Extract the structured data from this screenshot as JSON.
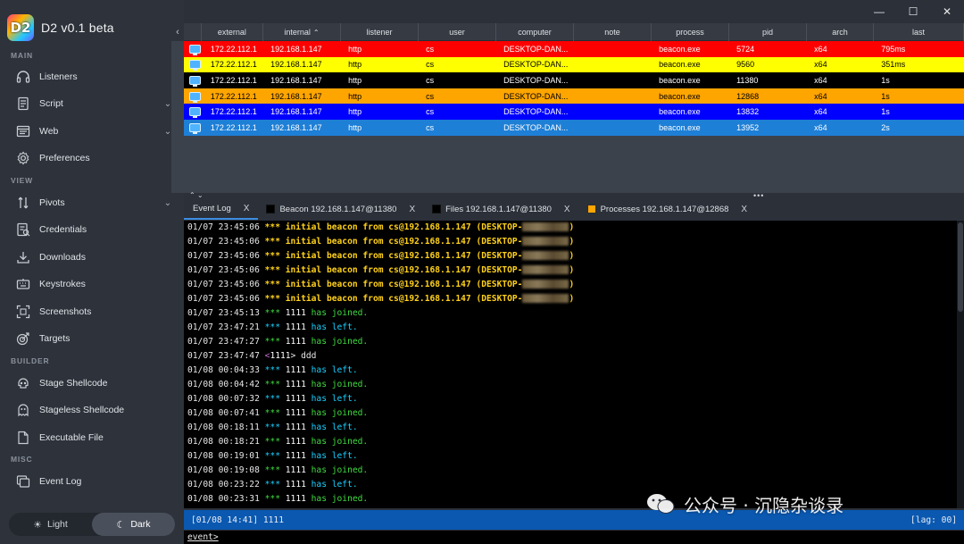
{
  "app": {
    "title": "D2 v0.1 beta",
    "logo_text": "D2"
  },
  "colors": {
    "red": "#ff0000",
    "yellow": "#ffff00",
    "black": "#000000",
    "orange": "#ffa500",
    "blue": "#0000ff",
    "lightblue": "#1e7fd6"
  },
  "sidebar": {
    "sections": {
      "main": "MAIN",
      "view": "VIEW",
      "builder": "BUILDER",
      "misc": "MISC"
    },
    "items": {
      "listeners": {
        "label": "Listeners",
        "icon": "headphones-icon"
      },
      "script": {
        "label": "Script",
        "icon": "script-icon"
      },
      "web": {
        "label": "Web",
        "icon": "web-icon"
      },
      "preferences": {
        "label": "Preferences",
        "icon": "gear-icon"
      },
      "pivots": {
        "label": "Pivots",
        "icon": "pivots-icon"
      },
      "credentials": {
        "label": "Credentials",
        "icon": "credentials-icon"
      },
      "downloads": {
        "label": "Downloads",
        "icon": "download-icon"
      },
      "keystrokes": {
        "label": "Keystrokes",
        "icon": "keyboard-icon"
      },
      "screenshots": {
        "label": "Screenshots",
        "icon": "screenshot-icon"
      },
      "targets": {
        "label": "Targets",
        "icon": "target-icon"
      },
      "stage_shellcode": {
        "label": "Stage Shellcode",
        "icon": "skull-icon"
      },
      "stageless_shellcode": {
        "label": "Stageless Shellcode",
        "icon": "ghost-icon"
      },
      "executable_file": {
        "label": "Executable File",
        "icon": "file-icon"
      },
      "event_log": {
        "label": "Event Log",
        "icon": "event-log-icon"
      }
    },
    "theme": {
      "light": "Light",
      "dark": "Dark"
    }
  },
  "table": {
    "columns": [
      "external",
      "internal",
      "listener",
      "user",
      "computer",
      "note",
      "process",
      "pid",
      "arch",
      "last"
    ],
    "sorted_column": "internal",
    "rows": [
      {
        "color": "red",
        "text": "#ffffff",
        "external": "172.22.112.1",
        "internal": "192.168.1.147",
        "listener": "http",
        "user": "cs",
        "computer": "DESKTOP-DAN...",
        "note": "",
        "process": "beacon.exe",
        "pid": "5724",
        "arch": "x64",
        "last": "795ms"
      },
      {
        "color": "yellow",
        "text": "#000000",
        "external": "172.22.112.1",
        "internal": "192.168.1.147",
        "listener": "http",
        "user": "cs",
        "computer": "DESKTOP-DAN...",
        "note": "",
        "process": "beacon.exe",
        "pid": "9560",
        "arch": "x64",
        "last": "351ms"
      },
      {
        "color": "black",
        "text": "#ffffff",
        "external": "172.22.112.1",
        "internal": "192.168.1.147",
        "listener": "http",
        "user": "cs",
        "computer": "DESKTOP-DAN...",
        "note": "",
        "process": "beacon.exe",
        "pid": "11380",
        "arch": "x64",
        "last": "1s"
      },
      {
        "color": "orange",
        "text": "#000000",
        "external": "172.22.112.1",
        "internal": "192.168.1.147",
        "listener": "http",
        "user": "cs",
        "computer": "DESKTOP-DAN...",
        "note": "",
        "process": "beacon.exe",
        "pid": "12868",
        "arch": "x64",
        "last": "1s"
      },
      {
        "color": "blue",
        "text": "#ffffff",
        "external": "172.22.112.1",
        "internal": "192.168.1.147",
        "listener": "http",
        "user": "cs",
        "computer": "DESKTOP-DAN...",
        "note": "",
        "process": "beacon.exe",
        "pid": "13832",
        "arch": "x64",
        "last": "1s"
      },
      {
        "color": "lightblue",
        "text": "#ffffff",
        "external": "172.22.112.1",
        "internal": "192.168.1.147",
        "listener": "http",
        "user": "cs",
        "computer": "DESKTOP-DAN...",
        "note": "",
        "process": "beacon.exe",
        "pid": "13952",
        "arch": "x64",
        "last": "2s"
      }
    ]
  },
  "tabs": [
    {
      "label": "Event Log",
      "close": "X",
      "active": true,
      "swatch": ""
    },
    {
      "label": "Beacon 192.168.1.147@11380",
      "close": "X",
      "active": false,
      "swatch": "#000000"
    },
    {
      "label": "Files 192.168.1.147@11380",
      "close": "X",
      "active": false,
      "swatch": "#000000"
    },
    {
      "label": "Processes 192.168.1.147@12868",
      "close": "X",
      "active": false,
      "swatch": "#ffa500"
    }
  ],
  "console": {
    "beacon_lines": [
      {
        "ts": "01/07 23:45:06",
        "text": "*** initial beacon from cs@192.168.1.147 (DESKTOP-",
        "tail": ")"
      },
      {
        "ts": "01/07 23:45:06",
        "text": "*** initial beacon from cs@192.168.1.147 (DESKTOP-",
        "tail": ")"
      },
      {
        "ts": "01/07 23:45:06",
        "text": "*** initial beacon from cs@192.168.1.147 (DESKTOP-",
        "tail": ")"
      },
      {
        "ts": "01/07 23:45:06",
        "text": "*** initial beacon from cs@192.168.1.147 (DESKTOP-",
        "tail": ")"
      },
      {
        "ts": "01/07 23:45:06",
        "text": "*** initial beacon from cs@192.168.1.147 (DESKTOP-",
        "tail": ")"
      },
      {
        "ts": "01/07 23:45:06",
        "text": "*** initial beacon from cs@192.168.1.147 (DESKTOP-",
        "tail": ")"
      }
    ],
    "events": [
      {
        "ts": "01/07 23:45:13",
        "type": "joined",
        "star": "***",
        "user": "1111",
        "msg": "has joined."
      },
      {
        "ts": "01/07 23:47:21",
        "type": "left",
        "star": "***",
        "user": "1111",
        "msg": "has left."
      },
      {
        "ts": "01/07 23:47:27",
        "type": "joined",
        "star": "***",
        "user": "1111",
        "msg": "has joined."
      },
      {
        "ts": "01/07 23:47:47",
        "type": "chat",
        "star": "",
        "user": "<1111>",
        "msg": "ddd"
      },
      {
        "ts": "01/08 00:04:33",
        "type": "left",
        "star": "***",
        "user": "1111",
        "msg": "has left."
      },
      {
        "ts": "01/08 00:04:42",
        "type": "joined",
        "star": "***",
        "user": "1111",
        "msg": "has joined."
      },
      {
        "ts": "01/08 00:07:32",
        "type": "left",
        "star": "***",
        "user": "1111",
        "msg": "has left."
      },
      {
        "ts": "01/08 00:07:41",
        "type": "joined",
        "star": "***",
        "user": "1111",
        "msg": "has joined."
      },
      {
        "ts": "01/08 00:18:11",
        "type": "left",
        "star": "***",
        "user": "1111",
        "msg": "has left."
      },
      {
        "ts": "01/08 00:18:21",
        "type": "joined",
        "star": "***",
        "user": "1111",
        "msg": "has joined."
      },
      {
        "ts": "01/08 00:19:01",
        "type": "left",
        "star": "***",
        "user": "1111",
        "msg": "has left."
      },
      {
        "ts": "01/08 00:19:08",
        "type": "joined",
        "star": "***",
        "user": "1111",
        "msg": "has joined."
      },
      {
        "ts": "01/08 00:23:22",
        "type": "left",
        "star": "***",
        "user": "1111",
        "msg": "has left."
      },
      {
        "ts": "01/08 00:23:31",
        "type": "joined",
        "star": "***",
        "user": "1111",
        "msg": "has joined."
      }
    ]
  },
  "statusbar": {
    "left": "[01/08 14:41] 1111",
    "right": "[lag: 00]"
  },
  "prompt": {
    "label": "event>"
  },
  "watermark": {
    "text": "公众号 · 沉隐杂谈录"
  }
}
